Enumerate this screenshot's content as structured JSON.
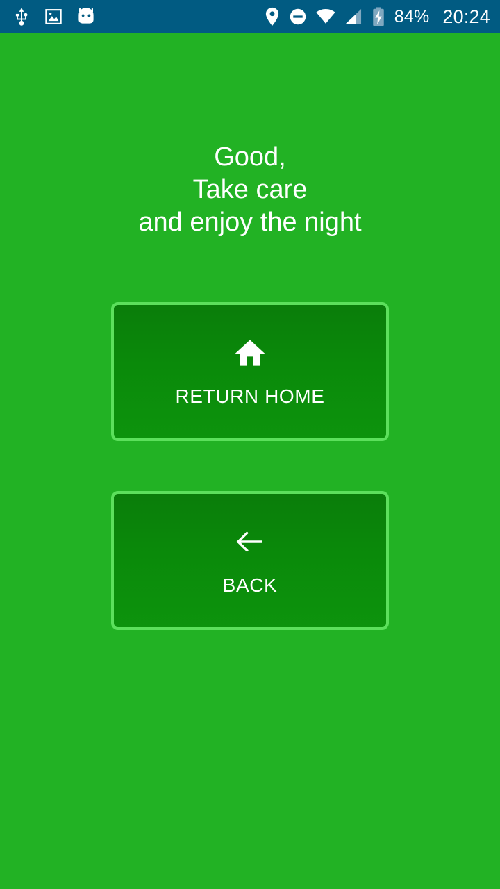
{
  "status_bar": {
    "background_color": "#015b82",
    "left_icons": [
      {
        "name": "usb-icon",
        "label": "USB connected"
      },
      {
        "name": "image-icon",
        "label": "Screenshot captured"
      },
      {
        "name": "android-head-icon",
        "label": "Android system"
      }
    ],
    "right_icons": [
      {
        "name": "location-pin-icon",
        "label": "Location on"
      },
      {
        "name": "do-not-disturb-icon",
        "label": "Do not disturb"
      },
      {
        "name": "wifi-icon",
        "label": "Wi-Fi full signal"
      },
      {
        "name": "cell-signal-icon",
        "label": "Mobile signal"
      },
      {
        "name": "battery-charging-icon",
        "label": "Battery charging"
      }
    ],
    "battery_percent": "84%",
    "clock": "20:24"
  },
  "screen": {
    "background_color": "#22b224",
    "greeting": "Good,\nTake care\nand enjoy the night"
  },
  "buttons": [
    {
      "id": "return-home",
      "label": "RETURN HOME",
      "icon": "home-icon",
      "border_color": "#5ce05c",
      "fill_color": "#0a8a0a"
    },
    {
      "id": "back",
      "label": "BACK",
      "icon": "arrow-left-icon",
      "border_color": "#5ce05c",
      "fill_color": "#0a8a0a"
    }
  ]
}
